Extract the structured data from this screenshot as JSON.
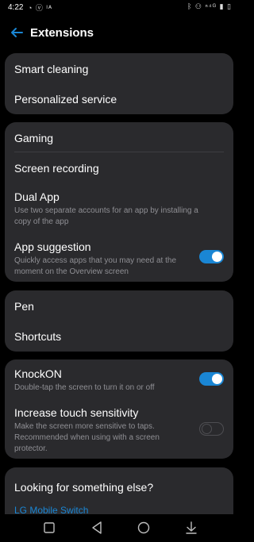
{
  "status_bar": {
    "time": "4:22",
    "left_icons": [
      "alarm-icon",
      "headset-icon",
      "signal-indicator-icon"
    ],
    "right_icons": [
      "bluetooth-icon",
      "vr-icon",
      "wifi-icon",
      "lte-icon",
      "signal-icon",
      "battery-icon"
    ],
    "left_icons_text": "◔ ⓥ ᴵᴬ",
    "right_icons_text": "ᛒ ⚇ ⁿ⁴ᴳ ▮ ▯"
  },
  "header": {
    "title": "Extensions"
  },
  "sections": {
    "group1": {
      "smart_cleaning": "Smart cleaning",
      "personalized_service": "Personalized service"
    },
    "group2": {
      "gaming": "Gaming",
      "screen_recording": "Screen recording",
      "dual_app": {
        "title": "Dual App",
        "description": "Use two separate accounts for an app by installing a copy of the app"
      },
      "app_suggestion": {
        "title": "App suggestion",
        "description": "Quickly access apps that you may need at the moment on the Overview screen",
        "enabled": true
      }
    },
    "group3": {
      "pen": "Pen",
      "shortcuts": "Shortcuts"
    },
    "group4": {
      "knockon": {
        "title": "KnockON",
        "description": "Double-tap the screen to turn it on or off",
        "enabled": true
      },
      "touch_sensitivity": {
        "title": "Increase touch sensitivity",
        "description": "Make the screen more sensitive to taps. Recommended when using with a screen protector.",
        "enabled": false
      }
    },
    "group5": {
      "title": "Looking for something else?",
      "link": "LG Mobile Switch"
    }
  },
  "nav_bar": {
    "buttons": [
      "recents-icon",
      "back-icon",
      "home-icon",
      "notifications-pull-icon"
    ]
  },
  "colors": {
    "background": "#000000",
    "card": "#2a2a2d",
    "accent": "#1a86d4",
    "secondary_text": "#8f8f94"
  }
}
